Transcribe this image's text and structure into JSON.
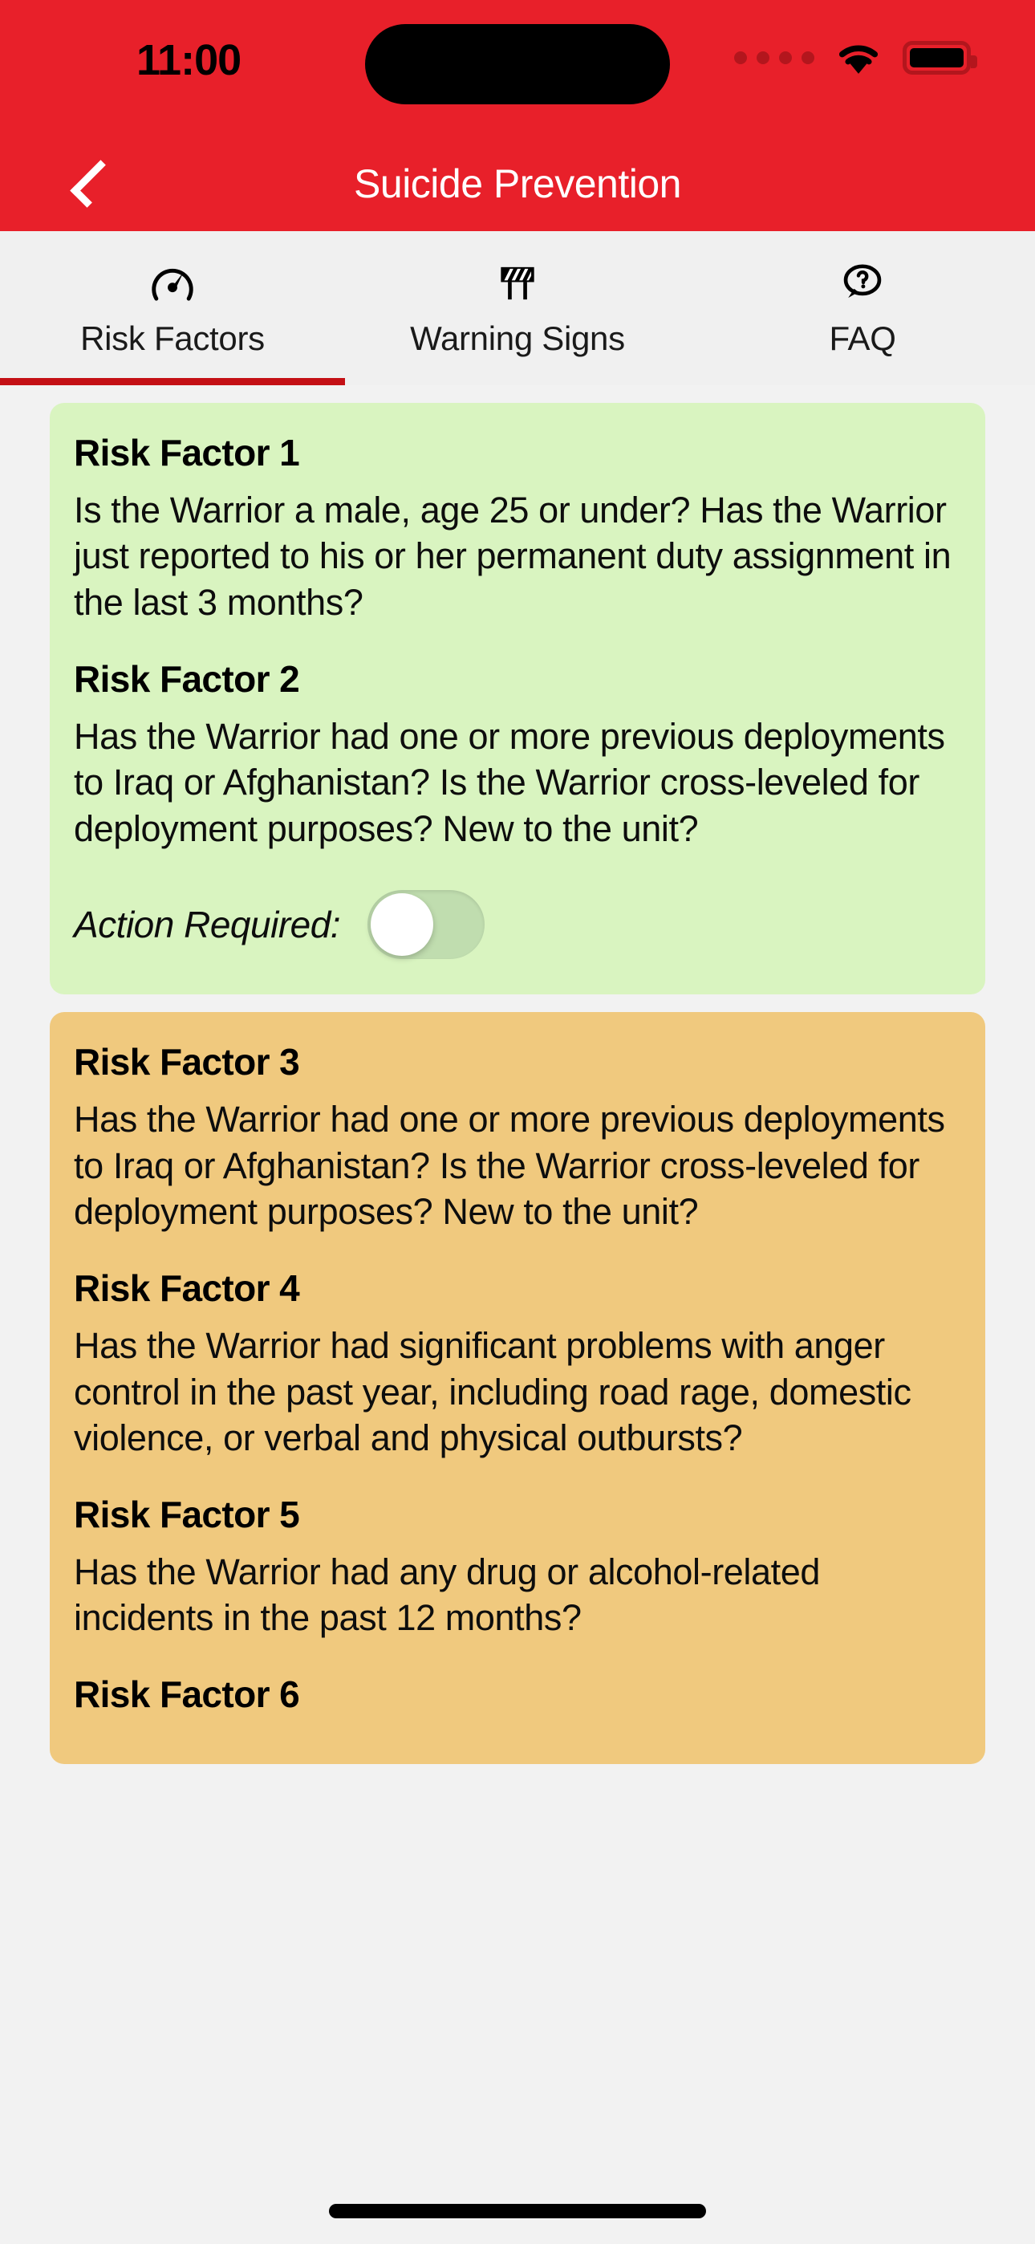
{
  "status_bar": {
    "time": "11:00",
    "cellular_icon": "cellular-dots-icon",
    "wifi_icon": "wifi-icon",
    "battery_icon": "battery-icon"
  },
  "nav": {
    "back_icon": "chevron-left-icon",
    "title": "Suicide Prevention"
  },
  "tabs": [
    {
      "label": "Risk Factors",
      "icon": "speedometer-icon",
      "active": true
    },
    {
      "label": "Warning Signs",
      "icon": "road-barrier-icon",
      "active": false
    },
    {
      "label": "FAQ",
      "icon": "question-bubble-icon",
      "active": false
    }
  ],
  "cards": [
    {
      "color": "#d9f4c0",
      "items": [
        {
          "title": "Risk Factor 1",
          "body": "Is the Warrior a male, age 25 or under? Has the Warrior just reported to his or her permanent duty assignment in the last 3 months?"
        },
        {
          "title": "Risk Factor 2",
          "body": "Has the Warrior had one or more previous deployments to Iraq or Afghanistan? Is the Warrior cross-leveled for deployment purposes? New to the unit?"
        }
      ],
      "action": {
        "label": "Action Required:",
        "toggle_on": false
      }
    },
    {
      "color": "#f0c97e",
      "items": [
        {
          "title": "Risk Factor 3",
          "body": "Has the Warrior had one or more previous deployments to Iraq or Afghanistan? Is the Warrior cross-leveled for deployment purposes? New to the unit?"
        },
        {
          "title": "Risk Factor 4",
          "body": "Has the Warrior had significant problems with anger control in the past year, including road rage, domestic violence, or verbal and physical outbursts?"
        },
        {
          "title": "Risk Factor 5",
          "body": "Has the Warrior had any drug or alcohol-related incidents in the past 12 months?"
        },
        {
          "title": "Risk Factor 6",
          "body": ""
        }
      ]
    }
  ],
  "theme": {
    "brand_red": "#e8202a",
    "underline_red": "#c41015",
    "page_bg": "#f2f2f2",
    "tabbar_bg": "#f0f0f0"
  }
}
